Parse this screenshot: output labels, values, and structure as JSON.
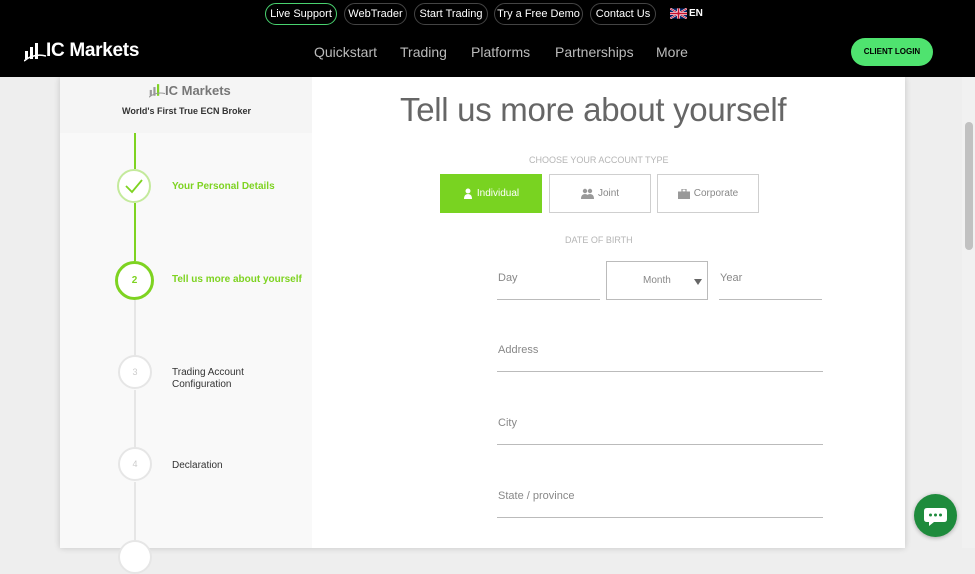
{
  "topbar": {
    "live_support": "Live Support",
    "webtrader": "WebTrader",
    "start_trading": "Start Trading",
    "free_demo": "Try a Free Demo",
    "contact_us": "Contact Us",
    "language": "EN"
  },
  "navbar": {
    "brand": "IC Markets",
    "items": [
      "Quickstart",
      "Trading",
      "Platforms",
      "Partnerships",
      "More"
    ],
    "client_login": "CLIENT LOGIN"
  },
  "sidebar": {
    "brand": "IC Markets",
    "tagline": "World's First True ECN Broker",
    "steps": [
      {
        "number": "",
        "label": "Your Personal Details",
        "state": "completed"
      },
      {
        "number": "2",
        "label": "Tell us more about yourself",
        "state": "current"
      },
      {
        "number": "3",
        "label": "Trading Account Configuration",
        "state": "upcoming"
      },
      {
        "number": "4",
        "label": "Declaration",
        "state": "upcoming"
      }
    ]
  },
  "form": {
    "heading": "Tell us more about yourself",
    "account_type_label": "CHOOSE YOUR ACCOUNT TYPE",
    "account_types": [
      "Individual",
      "Joint",
      "Corporate"
    ],
    "selected_account_type": "Individual",
    "dob_label": "DATE OF BIRTH",
    "day_placeholder": "Day",
    "month_placeholder": "Month",
    "year_placeholder": "Year",
    "address_placeholder": "Address",
    "city_placeholder": "City",
    "state_placeholder": "State / province"
  },
  "colors": {
    "accent": "#79d321",
    "login_button": "#4fe36f",
    "chat_button": "#1e8b3c"
  }
}
